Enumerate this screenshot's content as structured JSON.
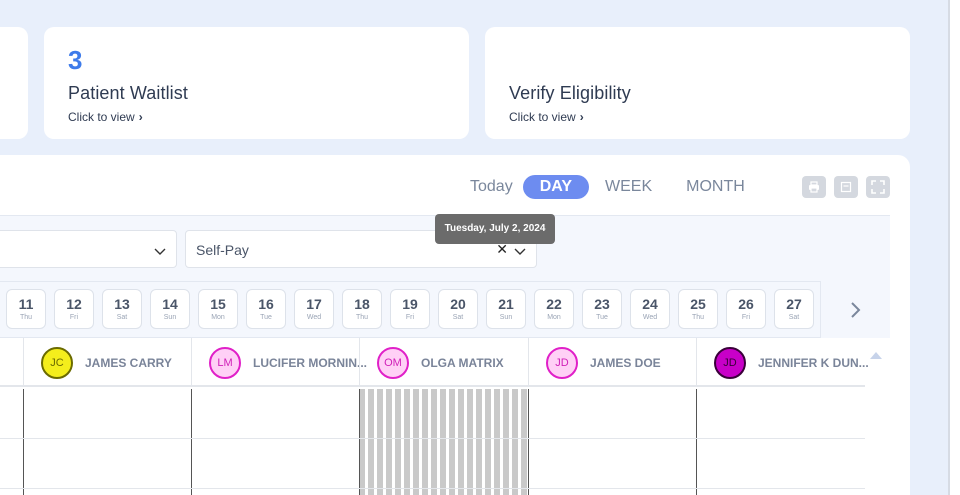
{
  "cards": {
    "waitlist": {
      "count": "3",
      "title": "Patient Waitlist",
      "link": "Click to view"
    },
    "verify": {
      "title": "Verify Eligibility",
      "link": "Click to view"
    }
  },
  "view_toggle": {
    "today": "Today",
    "day": "DAY",
    "week": "WEEK",
    "month": "MONTH",
    "active": "DAY"
  },
  "filters": {
    "insurance": {
      "value": "Self-Pay"
    }
  },
  "tooltip": "Tuesday, July 2, 2024",
  "dates": [
    {
      "num": "11",
      "dow": "Thu"
    },
    {
      "num": "12",
      "dow": "Fri"
    },
    {
      "num": "13",
      "dow": "Sat"
    },
    {
      "num": "14",
      "dow": "Sun"
    },
    {
      "num": "15",
      "dow": "Mon"
    },
    {
      "num": "16",
      "dow": "Tue"
    },
    {
      "num": "17",
      "dow": "Wed"
    },
    {
      "num": "18",
      "dow": "Thu"
    },
    {
      "num": "19",
      "dow": "Fri"
    },
    {
      "num": "20",
      "dow": "Sat"
    },
    {
      "num": "21",
      "dow": "Sun"
    },
    {
      "num": "22",
      "dow": "Mon"
    },
    {
      "num": "23",
      "dow": "Tue"
    },
    {
      "num": "24",
      "dow": "Wed"
    },
    {
      "num": "25",
      "dow": "Thu"
    },
    {
      "num": "26",
      "dow": "Fri"
    },
    {
      "num": "27",
      "dow": "Sat"
    }
  ],
  "providers": [
    {
      "initials": "JC",
      "name": "JAMES CARRY",
      "bg": "#f4ee1c",
      "border": "#6b6b00",
      "text": "#6b6b00"
    },
    {
      "initials": "LM",
      "name": "LUCIFER MORNIN...",
      "bg": "#ffd0f6",
      "border": "#e020c8",
      "text": "#d020b8"
    },
    {
      "initials": "OM",
      "name": "OLGA MATRIX",
      "bg": "#ffd0f6",
      "border": "#e020c8",
      "text": "#d020b8"
    },
    {
      "initials": "JD",
      "name": "JAMES DOE",
      "bg": "#ffd0f6",
      "border": "#e020c8",
      "text": "#d020b8"
    },
    {
      "initials": "JD",
      "name": "JENNIFER K DUN...",
      "bg": "#c800c8",
      "border": "#3a003a",
      "text": "#3a003a"
    }
  ]
}
